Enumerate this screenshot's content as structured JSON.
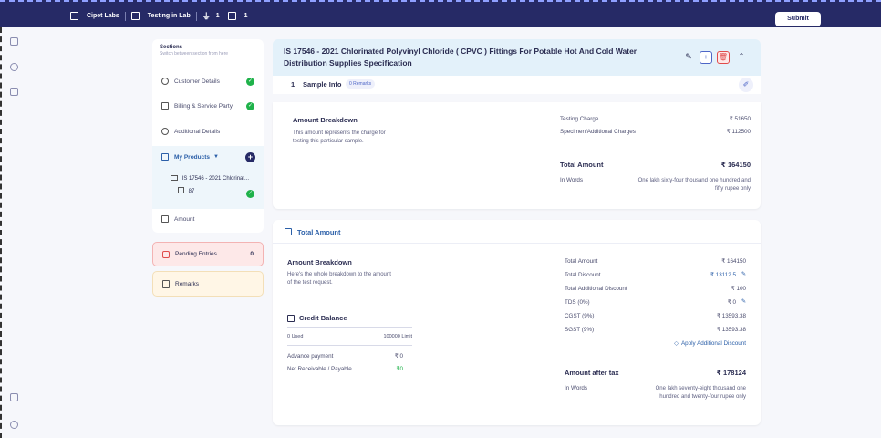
{
  "topbar": {
    "org": "Cipet Labs",
    "status": "Testing in Lab",
    "products_count": "1",
    "calendar_count": "1",
    "submit_label": "Submit"
  },
  "sections": {
    "title": "Sections",
    "subtitle": "Switch between section from here",
    "items": [
      {
        "label": "Customer Details",
        "icon": "user-circle-icon"
      },
      {
        "label": "Billing & Service Party",
        "icon": "truck-icon"
      },
      {
        "label": "Additional Details",
        "icon": "info-icon"
      },
      {
        "label": "My Products",
        "icon": "flask-icon"
      },
      {
        "label": "Amount",
        "icon": "receipt-icon"
      }
    ],
    "tree_product": "IS 17546 - 2021 Chlorinat...",
    "tree_sample": "87"
  },
  "pending": {
    "label": "Pending Entries",
    "count": "0"
  },
  "remarks": {
    "label": "Remarks"
  },
  "product": {
    "title": "IS 17546 - 2021 Chlorinated Polyvinyl Chloride ( CPVC ) Fittings For Potable Hot And Cold Water Distribution Supplies Specification",
    "sample_number": "1",
    "sample_label": "Sample Info",
    "remarks_badge": "0 Remarks"
  },
  "sample_amount": {
    "heading": "Amount Breakdown",
    "description": "This amount represents the charge for testing this particular sample.",
    "testing_charge_label": "Testing Charge",
    "testing_charge": "₹ 51650",
    "specimen_label": "Specimen/Additional Charges",
    "specimen": "₹ 112500",
    "total_label": "Total Amount",
    "total": "₹ 164150",
    "words_label": "In Words",
    "words": "One lakh sixty-four thousand one hundred and fifty rupee only"
  },
  "total_amount": {
    "tab_title": "Total Amount",
    "heading": "Amount Breakdown",
    "description": "Here's the whole breakdown to the amount of the test request.",
    "rows": [
      {
        "label": "Total Amount",
        "value": "₹ 164150"
      },
      {
        "label": "Total Discount",
        "value": "₹ 13112.5"
      },
      {
        "label": "Total Additional Discount",
        "value": "₹ 100"
      },
      {
        "label": "TDS (0%)",
        "value": "₹ 0"
      },
      {
        "label": "CGST (9%)",
        "value": "₹ 13593.38"
      },
      {
        "label": "SGST (9%)",
        "value": "₹ 13593.38"
      }
    ],
    "apply_discount": "Apply Additional Discount",
    "after_tax_label": "Amount after tax",
    "after_tax": "₹ 178124",
    "words_label": "In Words",
    "words": "One lakh seventy-eight thousand one hundred and twenty-four rupee only"
  },
  "credit": {
    "title": "Credit Balance",
    "used": "0 Used",
    "limit": "100000 Limit",
    "advance_label": "Advance payment",
    "advance": "₹ 0",
    "net_label": "Net Receivable / Payable",
    "net": "₹0",
    "net_color": "#1fb24a"
  }
}
